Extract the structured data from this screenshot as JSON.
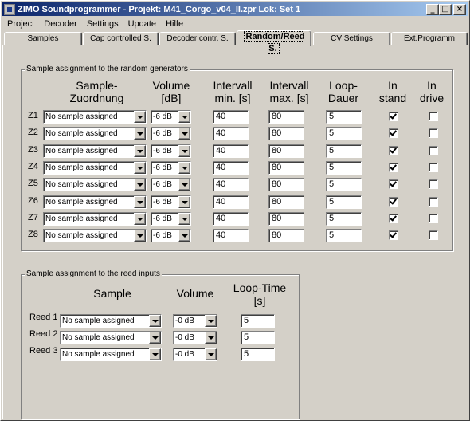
{
  "window": {
    "title": "ZIMO Soundprogrammer - Projekt: M41_Corgo_v04_II.zpr  Lok: Set 1",
    "minimize": "_",
    "maximize": "□",
    "close": "×"
  },
  "menu": [
    "Project",
    "Decoder",
    "Settings",
    "Update",
    "Hilfe"
  ],
  "tabs": [
    {
      "label": "Samples",
      "active": false
    },
    {
      "label": "Cap controlled S.",
      "active": false
    },
    {
      "label": "Decoder contr. S.",
      "active": false
    },
    {
      "label": "Random/Reed S.",
      "active": true
    },
    {
      "label": "CV Settings",
      "active": false
    },
    {
      "label": "Ext.Programm",
      "active": false
    }
  ],
  "random": {
    "group_title": "Sample assignment to the random generators",
    "headers": {
      "sample": "Sample-\nZuordnung",
      "volume": "Volume\n[dB]",
      "int_min": "Intervall\nmin. [s]",
      "int_max": "Intervall\nmax. [s]",
      "loop": "Loop-\nDauer",
      "stand": "In\nstand",
      "drive": "In\ndrive"
    },
    "rows": [
      {
        "label": "Z1",
        "sample": "No sample assigned",
        "volume": "-6 dB",
        "min": "40",
        "max": "80",
        "loop": "5",
        "stand": true,
        "drive": false
      },
      {
        "label": "Z2",
        "sample": "No sample assigned",
        "volume": "-6 dB",
        "min": "40",
        "max": "80",
        "loop": "5",
        "stand": true,
        "drive": false
      },
      {
        "label": "Z3",
        "sample": "No sample assigned",
        "volume": "-6 dB",
        "min": "40",
        "max": "80",
        "loop": "5",
        "stand": true,
        "drive": false
      },
      {
        "label": "Z4",
        "sample": "No sample assigned",
        "volume": "-6 dB",
        "min": "40",
        "max": "80",
        "loop": "5",
        "stand": true,
        "drive": false
      },
      {
        "label": "Z5",
        "sample": "No sample assigned",
        "volume": "-6 dB",
        "min": "40",
        "max": "80",
        "loop": "5",
        "stand": true,
        "drive": false
      },
      {
        "label": "Z6",
        "sample": "No sample assigned",
        "volume": "-6 dB",
        "min": "40",
        "max": "80",
        "loop": "5",
        "stand": true,
        "drive": false
      },
      {
        "label": "Z7",
        "sample": "No sample assigned",
        "volume": "-6 dB",
        "min": "40",
        "max": "80",
        "loop": "5",
        "stand": true,
        "drive": false
      },
      {
        "label": "Z8",
        "sample": "No sample assigned",
        "volume": "-6 dB",
        "min": "40",
        "max": "80",
        "loop": "5",
        "stand": true,
        "drive": false
      }
    ]
  },
  "reed": {
    "group_title": "Sample assignment to the reed inputs",
    "headers": {
      "sample": "Sample",
      "volume": "Volume",
      "loop": "Loop-Time\n[s]"
    },
    "rows": [
      {
        "label": "Reed 1",
        "sample": "No sample assigned",
        "volume": "-0 dB",
        "loop": "5"
      },
      {
        "label": "Reed 2",
        "sample": "No sample assigned",
        "volume": "-0 dB",
        "loop": "5"
      },
      {
        "label": "Reed 3",
        "sample": "No sample assigned",
        "volume": "-0 dB",
        "loop": "5"
      }
    ]
  }
}
